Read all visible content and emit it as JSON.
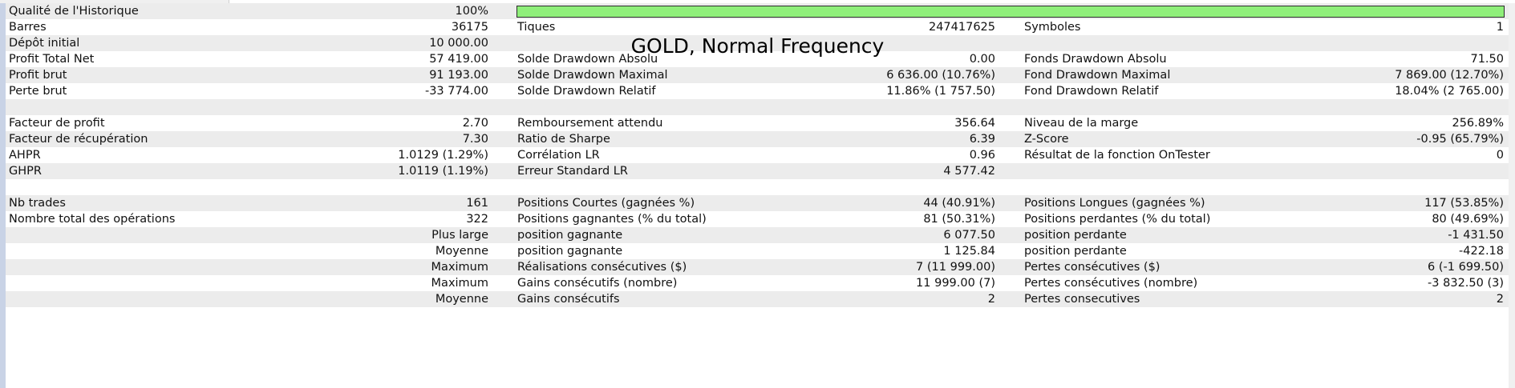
{
  "overlay_title": "GOLD, Normal Frequency",
  "quality": {
    "label": "Qualité de l'Historique",
    "value": "100%",
    "percent": 100,
    "bar_color": "#8fef7a"
  },
  "stats": [
    {
      "l1": "Barres",
      "v1": "36175",
      "l2": "Tiques",
      "v2": "247417625",
      "l3": "Symboles",
      "v3": "1"
    },
    {
      "l1": "Dépôt initial",
      "v1": "10 000.00",
      "l2": "",
      "v2": "",
      "l3": "",
      "v3": ""
    },
    {
      "l1": "Profit Total Net",
      "v1": "57 419.00",
      "l2": "Solde Drawdown Absolu",
      "v2": "0.00",
      "l3": "Fonds Drawdown Absolu",
      "v3": "71.50"
    },
    {
      "l1": "Profit brut",
      "v1": "91 193.00",
      "l2": "Solde Drawdown Maximal",
      "v2": "6 636.00 (10.76%)",
      "l3": "Fond Drawdown Maximal",
      "v3": "7 869.00 (12.70%)"
    },
    {
      "l1": "Perte brut",
      "v1": "-33 774.00",
      "l2": "Solde Drawdown Relatif",
      "v2": "11.86% (1 757.50)",
      "l3": "Fond Drawdown Relatif",
      "v3": "18.04% (2 765.00)"
    },
    {
      "l1": "",
      "v1": "",
      "l2": "",
      "v2": "",
      "l3": "",
      "v3": ""
    },
    {
      "l1": "Facteur de profit",
      "v1": "2.70",
      "l2": "Remboursement attendu",
      "v2": "356.64",
      "l3": "Niveau de la marge",
      "v3": "256.89%"
    },
    {
      "l1": "Facteur de récupération",
      "v1": "7.30",
      "l2": "Ratio de Sharpe",
      "v2": "6.39",
      "l3": "Z-Score",
      "v3": "-0.95 (65.79%)"
    },
    {
      "l1": "AHPR",
      "v1": "1.0129 (1.29%)",
      "l2": "Corrélation LR",
      "v2": "0.96",
      "l3": "Résultat de la fonction OnTester",
      "v3": "0"
    },
    {
      "l1": "GHPR",
      "v1": "1.0119 (1.19%)",
      "l2": "Erreur Standard LR",
      "v2": "4 577.42",
      "l3": "",
      "v3": ""
    },
    {
      "l1": "",
      "v1": "",
      "l2": "",
      "v2": "",
      "l3": "",
      "v3": ""
    },
    {
      "l1": "Nb trades",
      "v1": "161",
      "l2": "Positions Courtes (gagnées %)",
      "v2": "44 (40.91%)",
      "l3": "Positions Longues (gagnées %)",
      "v3": "117 (53.85%)"
    },
    {
      "l1": "Nombre total des opérations",
      "v1": "322",
      "l2": "Positions gagnantes (% du total)",
      "v2": "81 (50.31%)",
      "l3": "Positions perdantes (% du total)",
      "v3": "80 (49.69%)"
    },
    {
      "l1": "",
      "v1": "Plus large",
      "l2": "position gagnante",
      "v2": "6 077.50",
      "l3": "position perdante",
      "v3": "-1 431.50"
    },
    {
      "l1": "",
      "v1": "Moyenne",
      "l2": "position gagnante",
      "v2": "1 125.84",
      "l3": "position perdante",
      "v3": "-422.18"
    },
    {
      "l1": "",
      "v1": "Maximum",
      "l2": "Réalisations consécutives ($)",
      "v2": "7 (11 999.00)",
      "l3": "Pertes consécutives ($)",
      "v3": "6 (-1 699.50)"
    },
    {
      "l1": "",
      "v1": "Maximum",
      "l2": "Gains consécutifs (nombre)",
      "v2": "11 999.00 (7)",
      "l3": "Pertes consécutives (nombre)",
      "v3": "-3 832.50 (3)"
    },
    {
      "l1": "",
      "v1": "Moyenne",
      "l2": "Gains consécutifs",
      "v2": "2",
      "l3": "Pertes consecutives",
      "v3": "2"
    }
  ]
}
